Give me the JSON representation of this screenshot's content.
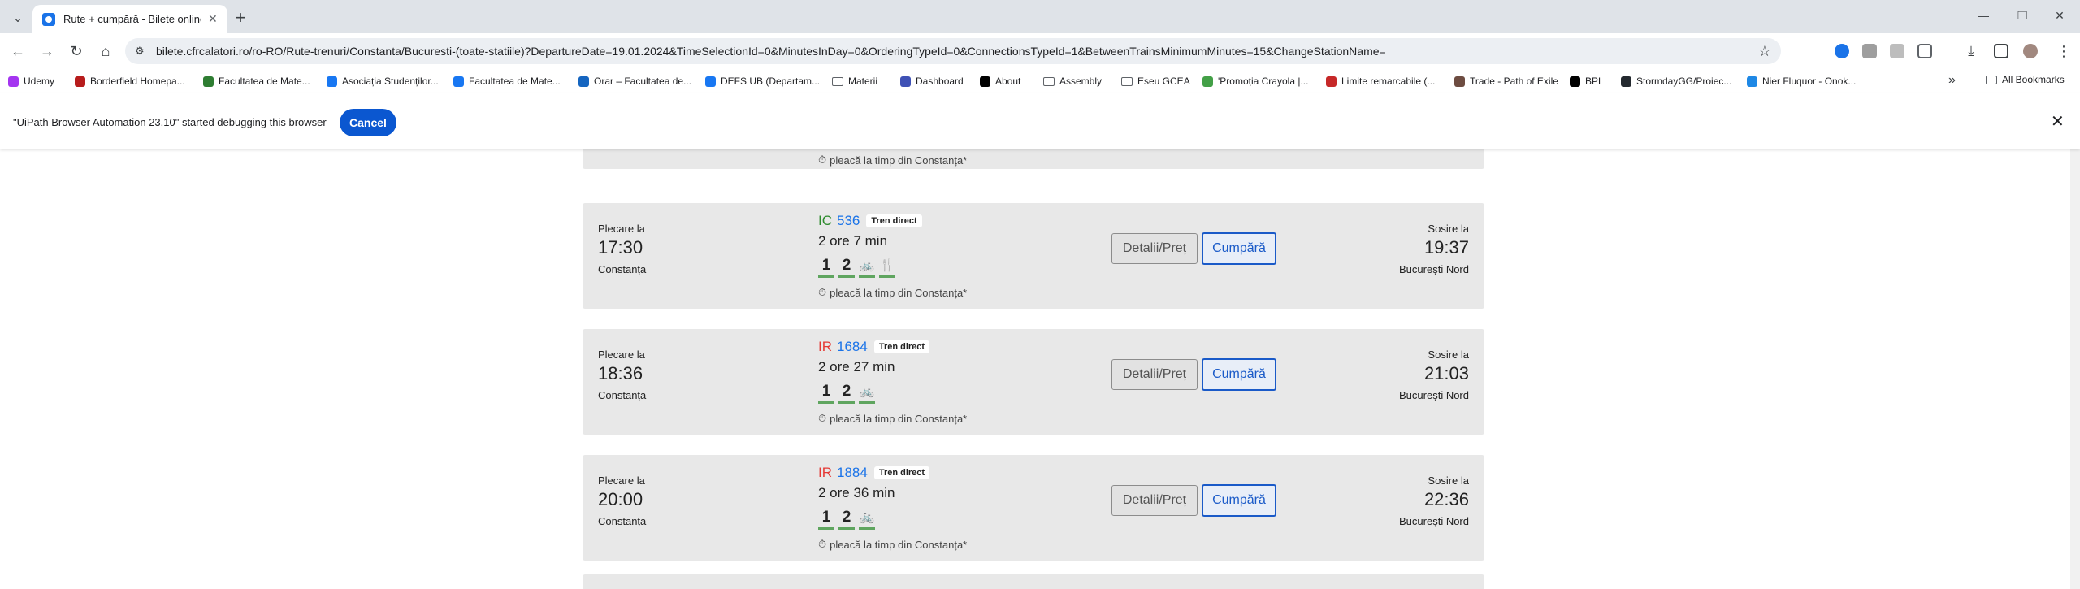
{
  "browser": {
    "tab_title": "Rute + cumpără - Bilete online",
    "url": "bilete.cfrcalatori.ro/ro-RO/Rute-trenuri/Constanta/Bucuresti-(toate-statiile)?DepartureDate=19.01.2024&TimeSelectionId=0&MinutesInDay=0&OrderingTypeId=0&ConnectionsTypeId=1&BetweenTrainsMinimumMinutes=15&ChangeStationName=",
    "bookmarks": [
      {
        "label": "Udemy",
        "icon_color": "#a435f0"
      },
      {
        "label": "Borderfield Homepa...",
        "icon_color": "#b71c1c"
      },
      {
        "label": "Facultatea de Mate...",
        "icon_color": "#2e7d32"
      },
      {
        "label": "Asociația Studenților...",
        "icon_color": "#1877f2"
      },
      {
        "label": "Facultatea de Mate...",
        "icon_color": "#1877f2"
      },
      {
        "label": "Orar – Facultatea de...",
        "icon_color": "#1565c0"
      },
      {
        "label": "DEFS UB (Departam...",
        "icon_color": "#1877f2"
      },
      {
        "label": "Materii",
        "icon_color": "folder"
      },
      {
        "label": "Dashboard",
        "icon_color": "#3f51b5"
      },
      {
        "label": "About",
        "icon_color": "#000000"
      },
      {
        "label": "Assembly",
        "icon_color": "folder"
      },
      {
        "label": "Eseu GCEA",
        "icon_color": "folder"
      },
      {
        "label": "'Promoția Crayola |...",
        "icon_color": "#43a047"
      },
      {
        "label": "Limite remarcabile (...",
        "icon_color": "#c62828"
      },
      {
        "label": "Trade - Path of Exile",
        "icon_color": "#6d4c41"
      },
      {
        "label": "BPL",
        "icon_color": "#000000"
      },
      {
        "label": "StormdayGG/Proiec...",
        "icon_color": "#24292f"
      },
      {
        "label": "Nier Fluquor - Onok...",
        "icon_color": "#1e88e5"
      }
    ],
    "all_bookmarks": "All Bookmarks"
  },
  "infobar": {
    "message": "\"UiPath Browser Automation 23.10\" started debugging this browser",
    "cancel_label": "Cancel"
  },
  "partial_card": {
    "note": "pleacă la timp din Constanța*"
  },
  "trains": [
    {
      "dep_label": "Plecare la",
      "dep_time": "17:30",
      "dep_station": "Constanța",
      "category": "IC",
      "category_color": "#2e8b2e",
      "number": "536",
      "badge": "Tren direct",
      "duration": "2 ore 7 min",
      "services": [
        "1",
        "2",
        "bike",
        "restaurant"
      ],
      "note": "pleacă la timp din Constanța*",
      "details_label": "Detalii/Preț",
      "buy_label": "Cumpără",
      "arr_label": "Sosire la",
      "arr_time": "19:37",
      "arr_station": "București Nord"
    },
    {
      "dep_label": "Plecare la",
      "dep_time": "18:36",
      "dep_station": "Constanța",
      "category": "IR",
      "category_color": "#e53935",
      "number": "1684",
      "badge": "Tren direct",
      "duration": "2 ore 27 min",
      "services": [
        "1",
        "2",
        "bike"
      ],
      "note": "pleacă la timp din Constanța*",
      "details_label": "Detalii/Preț",
      "buy_label": "Cumpără",
      "arr_label": "Sosire la",
      "arr_time": "21:03",
      "arr_station": "București Nord"
    },
    {
      "dep_label": "Plecare la",
      "dep_time": "20:00",
      "dep_station": "Constanța",
      "category": "IR",
      "category_color": "#e53935",
      "number": "1884",
      "badge": "Tren direct",
      "duration": "2 ore 36 min",
      "services": [
        "1",
        "2",
        "bike"
      ],
      "note": "pleacă la timp din Constanța*",
      "details_label": "Detalii/Preț",
      "buy_label": "Cumpără",
      "arr_label": "Sosire la",
      "arr_time": "22:36",
      "arr_station": "București Nord"
    }
  ]
}
